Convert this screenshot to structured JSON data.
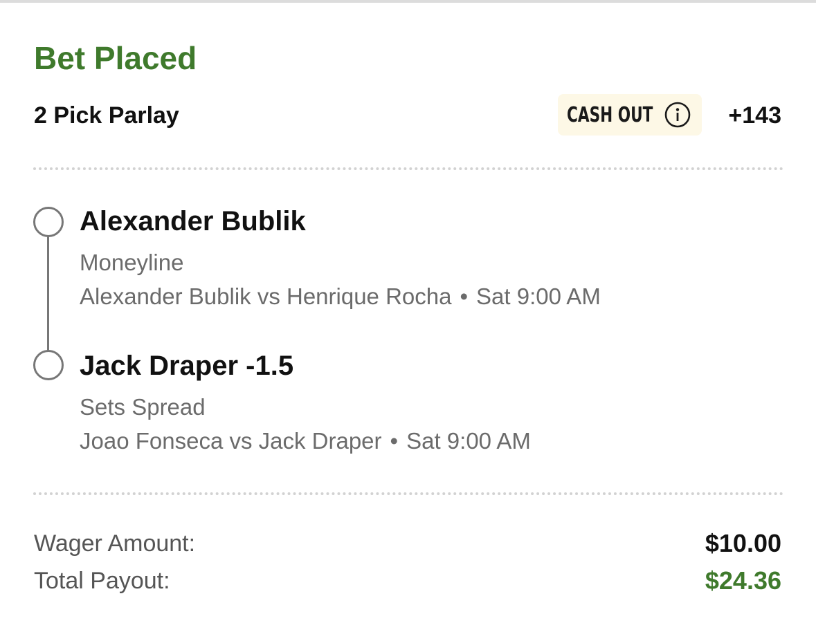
{
  "bet": {
    "status": "Bet Placed",
    "type": "2 Pick Parlay",
    "cashout_label": "CASH OUT",
    "odds": "+143"
  },
  "legs": [
    {
      "selection": "Alexander Bublik",
      "market": "Moneyline",
      "matchup": "Alexander Bublik vs Henrique Rocha",
      "separator": "•",
      "time": "Sat 9:00 AM"
    },
    {
      "selection": "Jack Draper -1.5",
      "market": "Sets Spread",
      "matchup": "Joao Fonseca vs Jack Draper",
      "separator": "•",
      "time": "Sat 9:00 AM"
    }
  ],
  "summary": {
    "wager_label": "Wager Amount:",
    "wager_value": "$10.00",
    "payout_label": "Total Payout:",
    "payout_value": "$24.36"
  },
  "icons": {
    "info": "info-icon",
    "leg_status": "empty-circle-icon"
  },
  "colors": {
    "success_green": "#3f7a2c",
    "cashout_bg": "#fdf8e6",
    "muted_text": "#6b6b6b"
  }
}
